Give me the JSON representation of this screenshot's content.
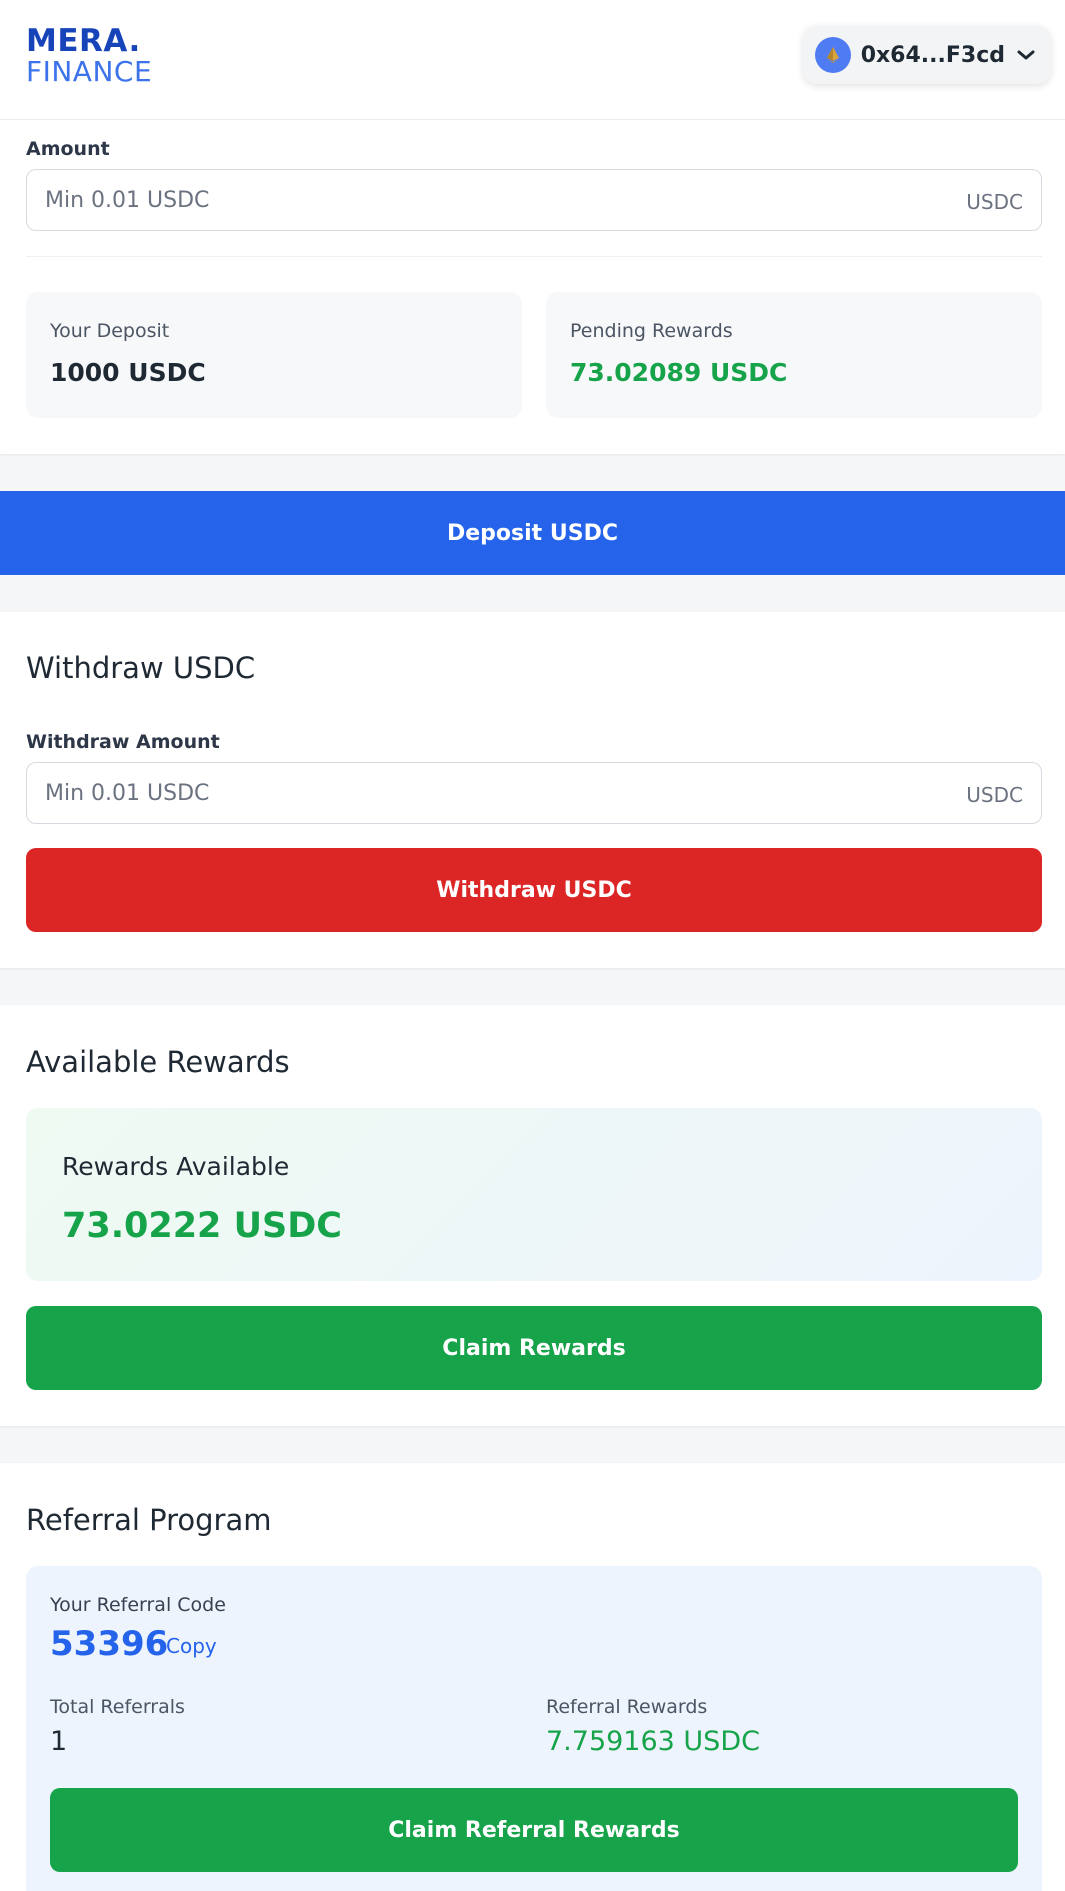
{
  "header": {
    "logo_line1": "MERA.",
    "logo_line2": "FINANCE",
    "wallet_address": "0x64...F3cd"
  },
  "deposit": {
    "amount_label": "Amount",
    "amount_placeholder": "Min 0.01 USDC",
    "amount_unit": "USDC",
    "your_deposit_label": "Your Deposit",
    "your_deposit_value": "1000 USDC",
    "pending_rewards_label": "Pending Rewards",
    "pending_rewards_value": "73.02089 USDC",
    "button_label": "Deposit USDC"
  },
  "withdraw": {
    "title": "Withdraw USDC",
    "amount_label": "Withdraw Amount",
    "amount_placeholder": "Min 0.01 USDC",
    "amount_unit": "USDC",
    "button_label": "Withdraw USDC"
  },
  "rewards": {
    "title": "Available Rewards",
    "box_label": "Rewards Available",
    "box_value": "73.0222 USDC",
    "button_label": "Claim Rewards"
  },
  "referral": {
    "title": "Referral Program",
    "code_label": "Your Referral Code",
    "code_value": "53396",
    "copy_label": "Copy",
    "total_referrals_label": "Total Referrals",
    "total_referrals_value": "1",
    "referral_rewards_label": "Referral Rewards",
    "referral_rewards_value": "7.759163 USDC",
    "button_label": "Claim Referral Rewards"
  },
  "colors": {
    "primary_blue": "#2563eb",
    "danger_red": "#dc2626",
    "success_green": "#16a34a",
    "logo_dark_blue": "#1745b9"
  },
  "icons": {
    "wallet_network": "eth-coin-icon",
    "wallet_menu": "chevron-down-icon"
  }
}
